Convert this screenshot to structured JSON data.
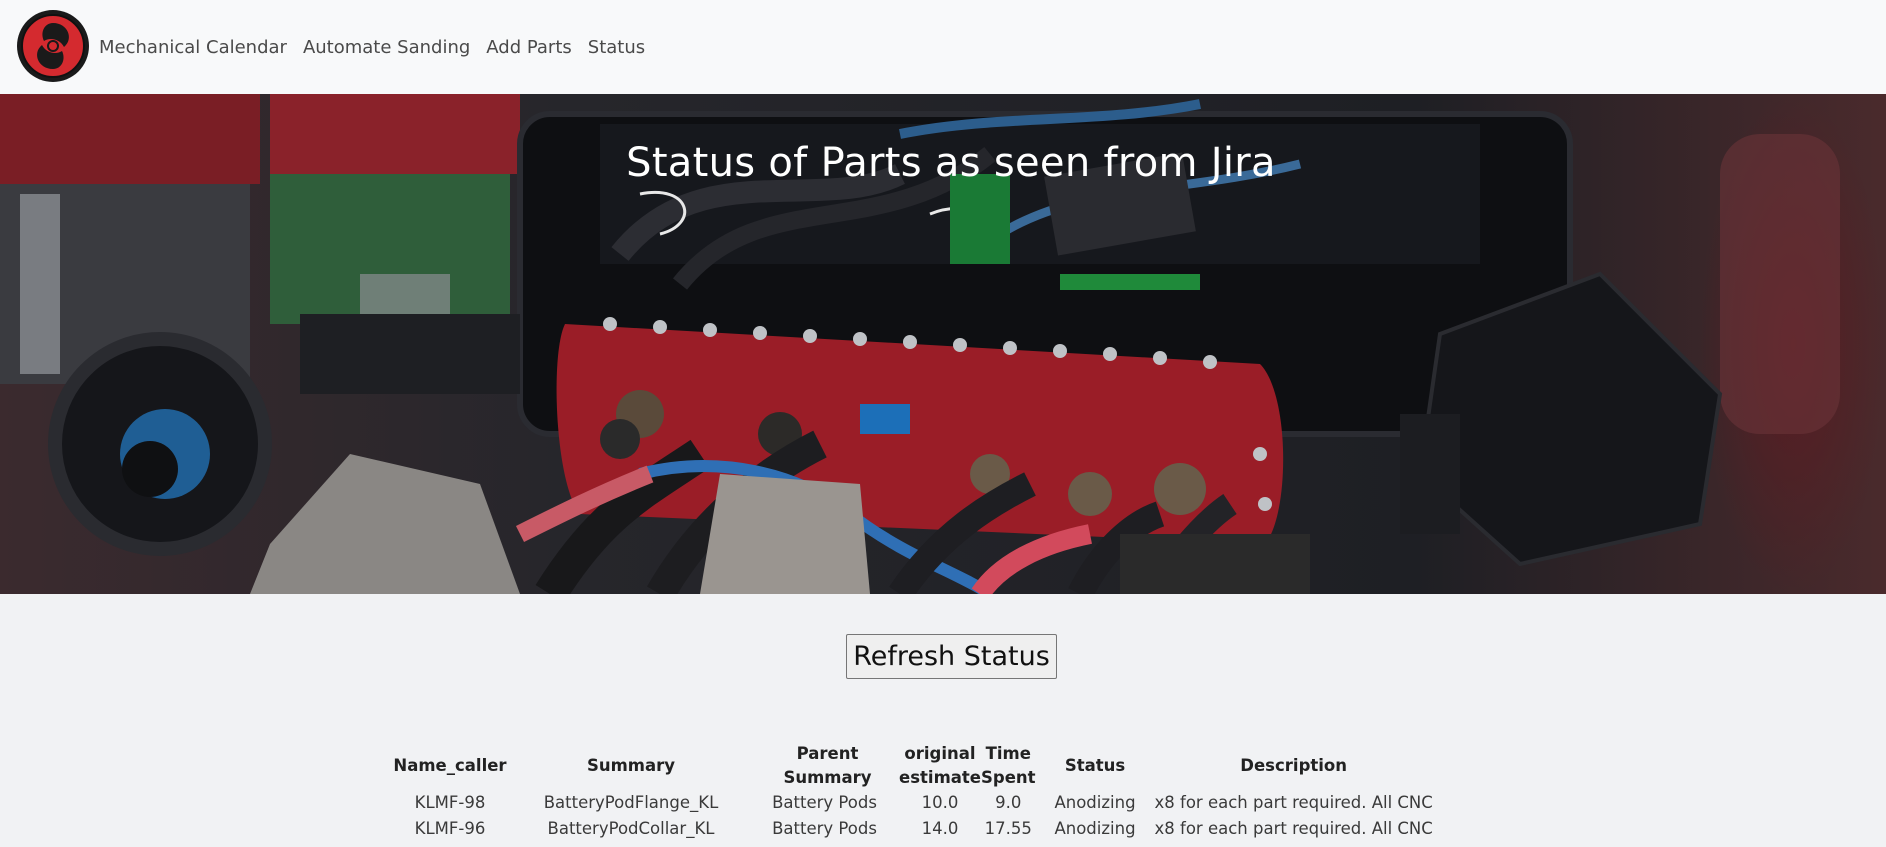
{
  "nav": {
    "logo_icon": "team-logo-icon",
    "links": [
      "Mechanical Calendar",
      "Automate Sanding",
      "Add Parts",
      "Status"
    ]
  },
  "hero": {
    "title": "Status of Parts as seen from Jira",
    "image": "robot-electronics-photo"
  },
  "refresh_label": "Refresh Status",
  "table": {
    "headers": {
      "name_caller": "Name_caller",
      "summary": "Summary",
      "parent_summary": "Parent Summary",
      "original_estimate": "original estimate",
      "time_spent": "Time Spent",
      "status": "Status",
      "description": "Description"
    },
    "rows": [
      {
        "name_caller": "KLMF-98",
        "summary": "BatteryPodFlange_KL",
        "parent_summary": "Battery Pods",
        "original_estimate": "10.0",
        "time_spent": "9.0",
        "status": "Anodizing",
        "description": "x8 for each part required. All CNC"
      },
      {
        "name_caller": "KLMF-96",
        "summary": "BatteryPodCollar_KL",
        "parent_summary": "Battery Pods",
        "original_estimate": "14.0",
        "time_spent": "17.55",
        "status": "Anodizing",
        "description": "x8 for each part required. All CNC"
      }
    ]
  },
  "colors": {
    "navbar_bg": "#f8f9fa",
    "page_bg": "#f1f2f4",
    "logo_red": "#d42a2f"
  }
}
